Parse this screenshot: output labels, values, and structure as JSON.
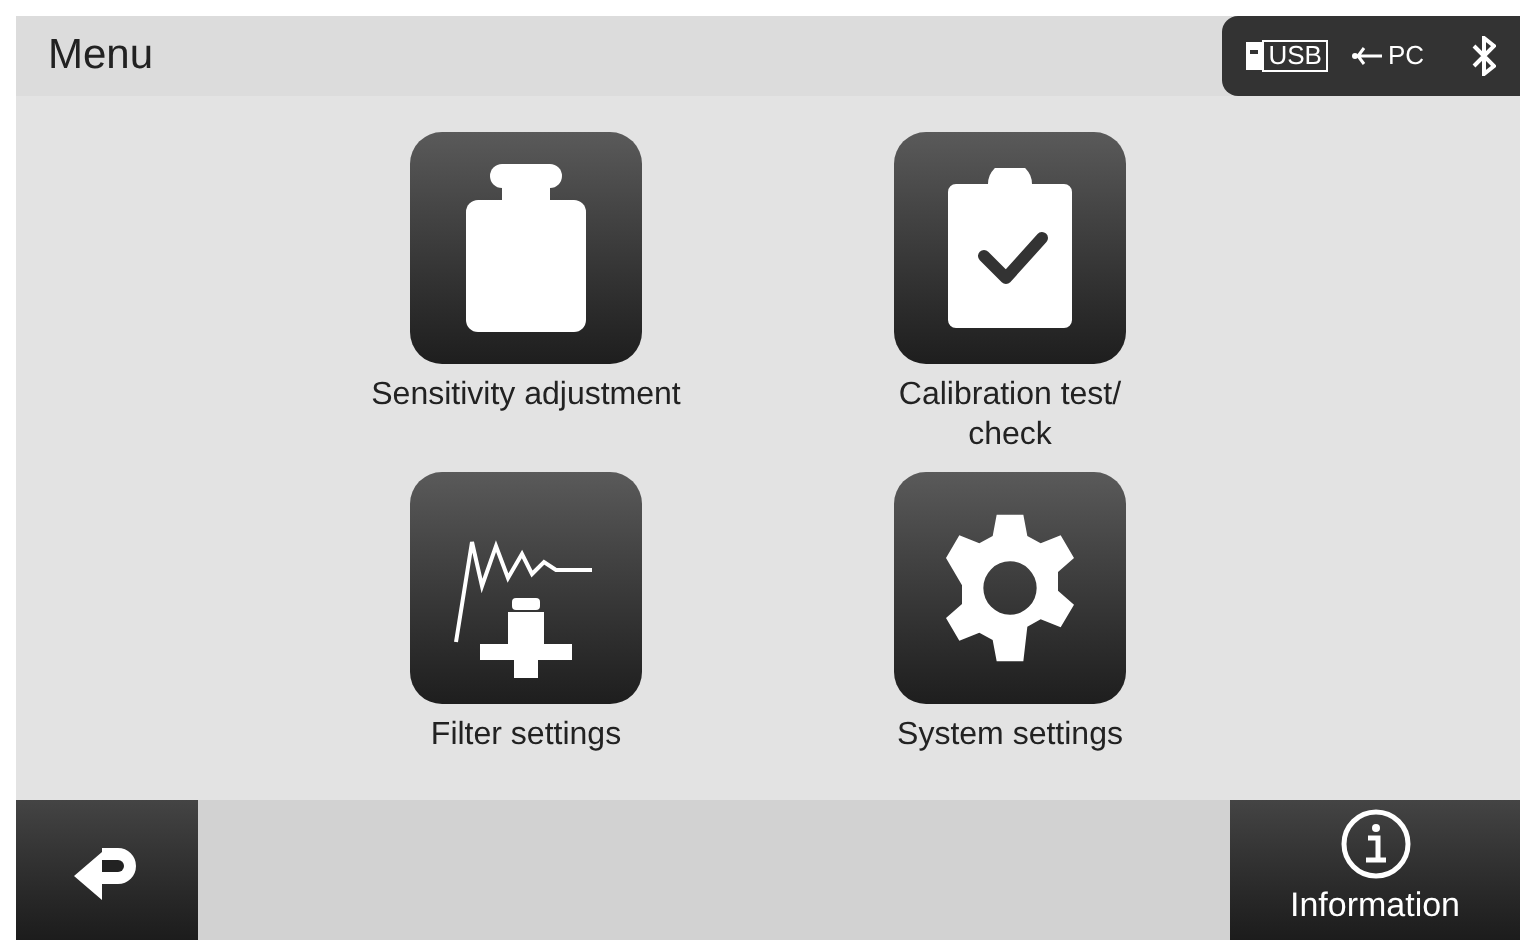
{
  "header": {
    "title": "Menu",
    "status": {
      "usb": "USB",
      "pc": "PC"
    }
  },
  "tiles": [
    {
      "kind": "weight",
      "label": "Sensitivity adjustment"
    },
    {
      "kind": "clipboard",
      "label": "Calibration test/\ncheck"
    },
    {
      "kind": "filter",
      "label": "Filter settings"
    },
    {
      "kind": "gear",
      "label": "System settings"
    }
  ],
  "footer": {
    "info_label": "Information"
  }
}
